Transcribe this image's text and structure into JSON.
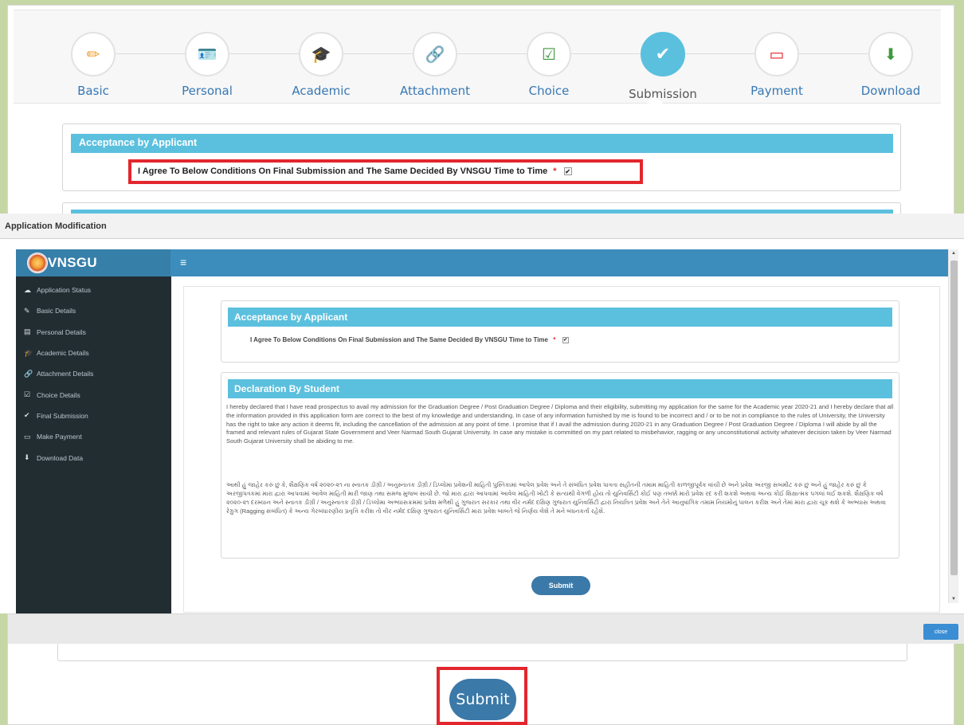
{
  "wizard": {
    "steps": [
      {
        "label": "Basic",
        "icon": "pencil-icon",
        "glyph": "✏",
        "color": "#f0a030"
      },
      {
        "label": "Personal",
        "icon": "id-card-icon",
        "glyph": "🪪",
        "color": "#3778b4"
      },
      {
        "label": "Academic",
        "icon": "graduation-cap-icon",
        "glyph": "🎓",
        "color": "#d9534f"
      },
      {
        "label": "Attachment",
        "icon": "link-icon",
        "glyph": "🔗",
        "color": "#e040a0"
      },
      {
        "label": "Choice",
        "icon": "checkbox-icon",
        "glyph": "☑",
        "color": "#3c9a3c"
      },
      {
        "label": "Submission",
        "icon": "check-icon",
        "glyph": "✔",
        "color": "#ffffff"
      },
      {
        "label": "Payment",
        "icon": "credit-card-icon",
        "glyph": "▭",
        "color": "#e3262e"
      },
      {
        "label": "Download",
        "icon": "download-icon",
        "glyph": "⬇",
        "color": "#3c9a3c"
      }
    ],
    "active": "Submission"
  },
  "acceptance": {
    "heading": "Acceptance by Applicant",
    "agree_text": "I Agree To Below Conditions On Final Submission and The Same Decided By VNSGU Time to Time",
    "required_mark": "*",
    "checked": true
  },
  "bg_submit_label": "Submit",
  "modal": {
    "title": "Application Modification",
    "close_label": "close",
    "brand": "VNSGU",
    "menu_toggle": "≡",
    "sidebar": [
      {
        "label": "Application Status",
        "glyph": "☁"
      },
      {
        "label": "Basic Details",
        "glyph": "✎"
      },
      {
        "label": "Personal Details",
        "glyph": "▤"
      },
      {
        "label": "Academic Details",
        "glyph": "🎓"
      },
      {
        "label": "Attachment Details",
        "glyph": "🔗"
      },
      {
        "label": "Choice Details",
        "glyph": "☑"
      },
      {
        "label": "Final Submission",
        "glyph": "✔"
      },
      {
        "label": "Make Payment",
        "glyph": "▭"
      },
      {
        "label": "Download Data",
        "glyph": "⬇"
      }
    ],
    "acceptance_heading": "Acceptance by Applicant",
    "agree_text": "I Agree To Below Conditions On Final Submission and The Same Decided By VNSGU Time to Time",
    "required_mark": "*",
    "declaration_heading": "Declaration By Student",
    "declaration_en": "I hereby declared that I have read prospectus to avail my admission for the Graduation Degree / Post Graduation Degree / Diploma and their eligibility, submitting my application for the same for the Academic year 2020-21 and I hereby declare that all the information provided in this application form are correct to the best of my knowledge and understanding. In case of any information furnished by me is found to be incorrect and / or to be not in compliance to the rules of University, the University has the right to take any action it deems fit, including the cancellation of the admission at any point of time. I promise that if I avail the admission during 2020-21 in any Graduation Degree / Post Graduation Degree / Diploma I will abide by all the framed and relevant rules of Gujarat State Government and Veer Narmad South Gujarat University. In case any mistake is committed on my part related to misbehavior, ragging or any unconstitutional activity whatever decision taken by Veer Narmad South Gujarat University shall be abiding to me.",
    "declaration_gu": "આથી હું જાહેર કરું છું કે, શૈક્ષણિક વર્ષ ૨૦૨૦-૨૧ ના સ્નાતક ડીગ્રી / અનુસ્નાતક ડીગ્રી / ડિપ્લોમા પ્રવેશની માહિતી પુસ્તિકામાં આપેલ પ્રવેશ અને તે સંબંધિત પ્રવેશ પાત્રતા સહીતની તમામ માહિતી કાળજીપૂર્વક વાંચી છે અને પ્રવેશ અરજી સબમીટ કરું છું અને હું જાહેર કરું છું કે અરજીપત્રકમાં મારા દ્વારા આપવામાં આવેલ માહિતી મારી જાણ તથા સમજ મુજબ સાચી છે. જો મારા દ્વારા આપવામાં આવેલ માહિતી ખોટી કે સત્યથી વેગળી હોય તો યુનિવર્સિટી કોઈ પણ તબક્કે મારો પ્રવેશ રદ કરી શકશે અથવા અન્ય કોઈ શિક્ષાત્મક પગલાં લઈ શકશે. શૈક્ષણિક વર્ષ ૨૦૨૦-૨૧ દરમ્યાન અને સ્નાતક ડીગ્રી / અનુસ્નાતક ડીગ્રી / ડિપ્લોમા અભ્યાસક્રમમાં પ્રવેશ મળેથી હું ગુજરાત સરકાર તથા વીર નર્મદ દક્ષિણ ગુજરાત યુનિવર્સિટી દ્વારા નિયત્રિત પ્રવેશ અને તેને આનુષાંગિક તમામ નિયમોનું પાલન કરીશ અને તેમાં મારા દ્વારા ચૂક થશે કે અભ્યાસ અથવા રેગ્રુગ (Ragging સંબંધિત) કે અન્ય ગેરબંધારણીય પ્રવૃત્તિ કરીશ તો વીર નર્મદ દક્ષિણ ગુજરાત યુનિવર્સિટી મારા પ્રવેશ બાબતે જે નિર્ણય લેશે તે મને બંધનકર્તા રહેશે.",
    "submit_label": "Submit"
  }
}
